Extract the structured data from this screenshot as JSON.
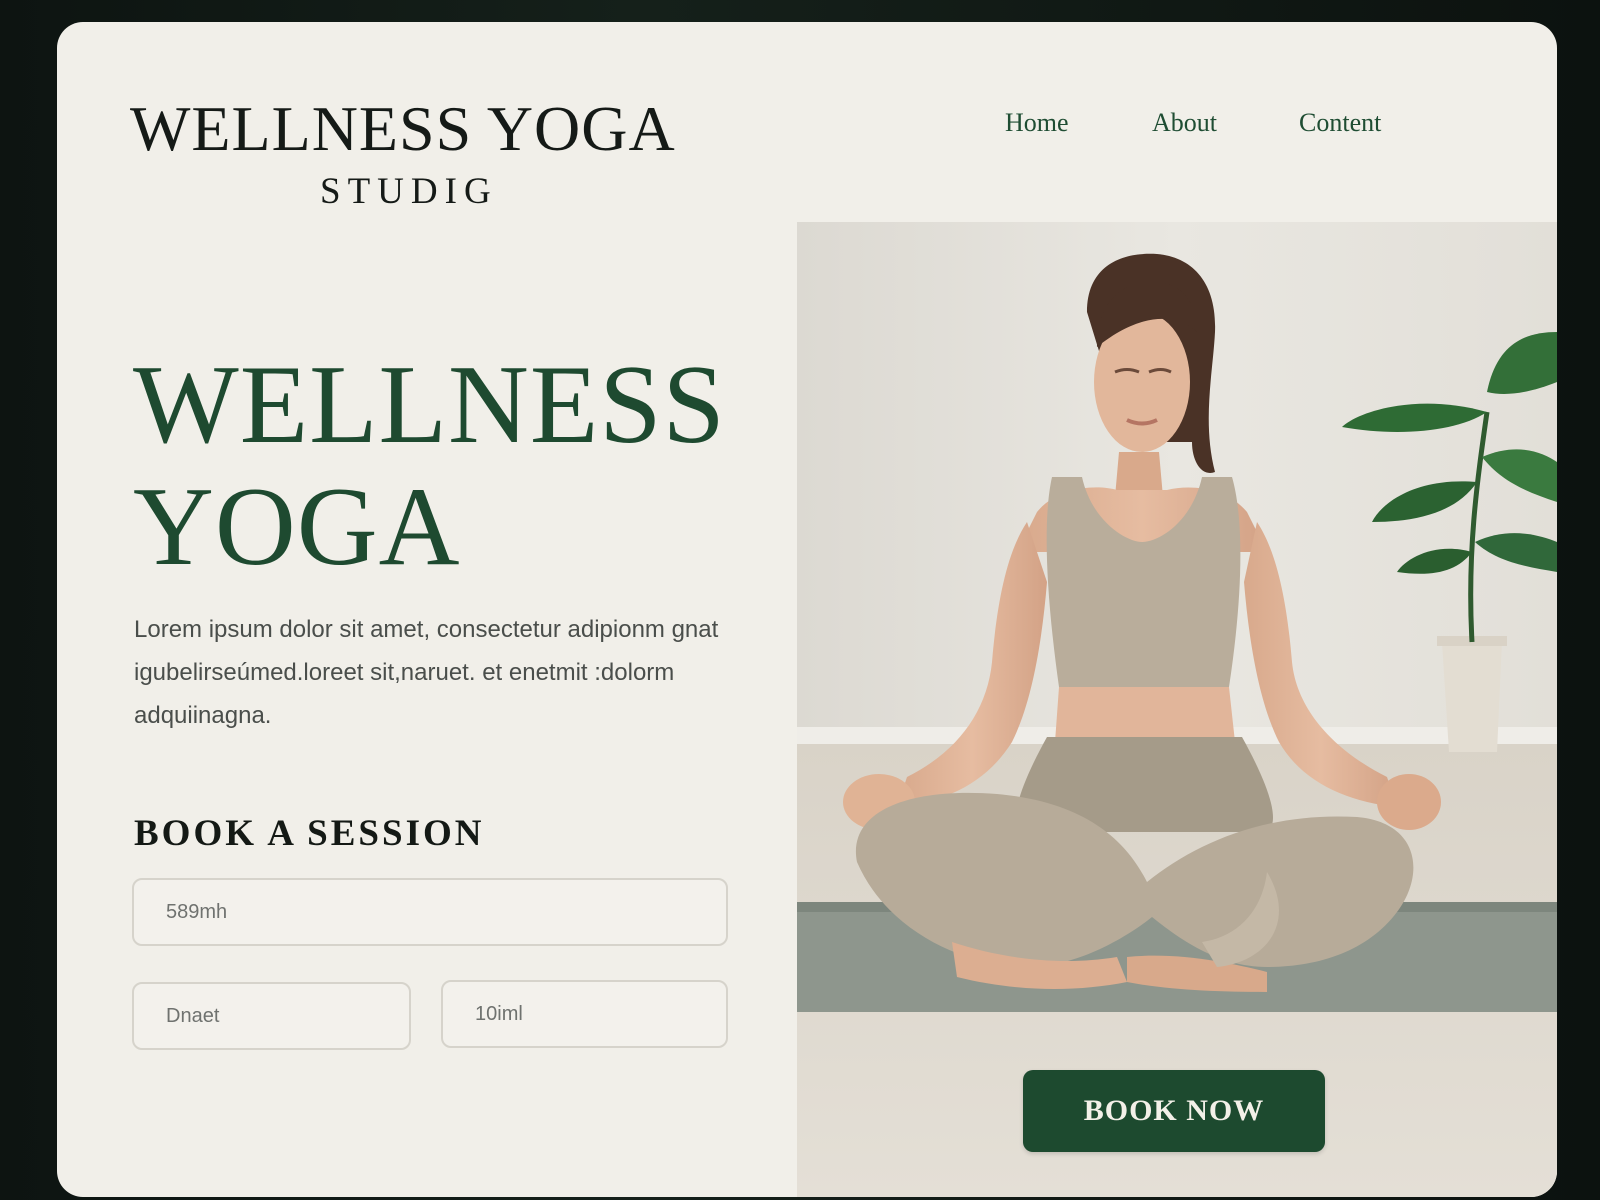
{
  "brand": {
    "title": "WELLNESS YOGA",
    "subtitle": "STUDIG"
  },
  "nav": {
    "items": [
      "Home",
      "About",
      "Content"
    ]
  },
  "hero": {
    "title_line1": "WELLNESS",
    "title_line2": "YOGA",
    "text": "Lorem ipsum dolor sit amet, consectetur adipionm gnat igubelirseúmed.loreet sit,naruet. et enetmit :dolorm adquiinagna."
  },
  "booking": {
    "heading": "BOOK A SESSION",
    "field_1": "589mh",
    "field_2": "Dnaet",
    "field_3": "10iml",
    "cta": "BOOK NOW"
  },
  "colors": {
    "accent": "#1d4a2f",
    "background": "#f1efe9",
    "text": "#151a17"
  },
  "icons": {
    "plant": "plant-icon",
    "person": "person-meditating-illustration"
  }
}
